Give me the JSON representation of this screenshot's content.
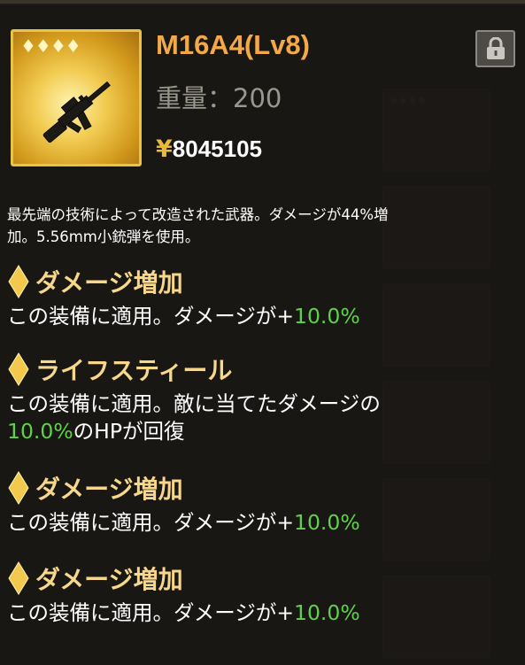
{
  "item": {
    "rarity_diamonds": "♦♦♦♦",
    "name": "M16A4(Lv8)",
    "weight_label": "重量：",
    "weight_value": "200",
    "currency": "¥",
    "price": "8045105",
    "icon": "rifle-icon"
  },
  "lock": {
    "icon": "lock-icon"
  },
  "description": {
    "line1": "最先端の技術によって改造された武器。ダメージが44%増",
    "line2": "加。5.56mm小銃弾を使用。"
  },
  "skills": [
    {
      "name": "ダメージ増加",
      "desc_prefix": "この装備に適用。ダメージが+",
      "value": "10.0%",
      "desc_suffix": ""
    },
    {
      "name": "ライフスティール",
      "desc_prefix": "この装備に適用。敵に当てたダメージの",
      "value": "10.0%",
      "desc_suffix": "のHPが回復"
    },
    {
      "name": "ダメージ増加",
      "desc_prefix": "この装備に適用。ダメージが+",
      "value": "10.0%",
      "desc_suffix": ""
    },
    {
      "name": "ダメージ増加",
      "desc_prefix": "この装備に適用。ダメージが+",
      "value": "10.0%",
      "desc_suffix": ""
    }
  ],
  "colors": {
    "name": "#f3a948",
    "skill_title": "#f6d78b",
    "value_green": "#5fd14a",
    "frame_gold": "#e8c34a"
  }
}
